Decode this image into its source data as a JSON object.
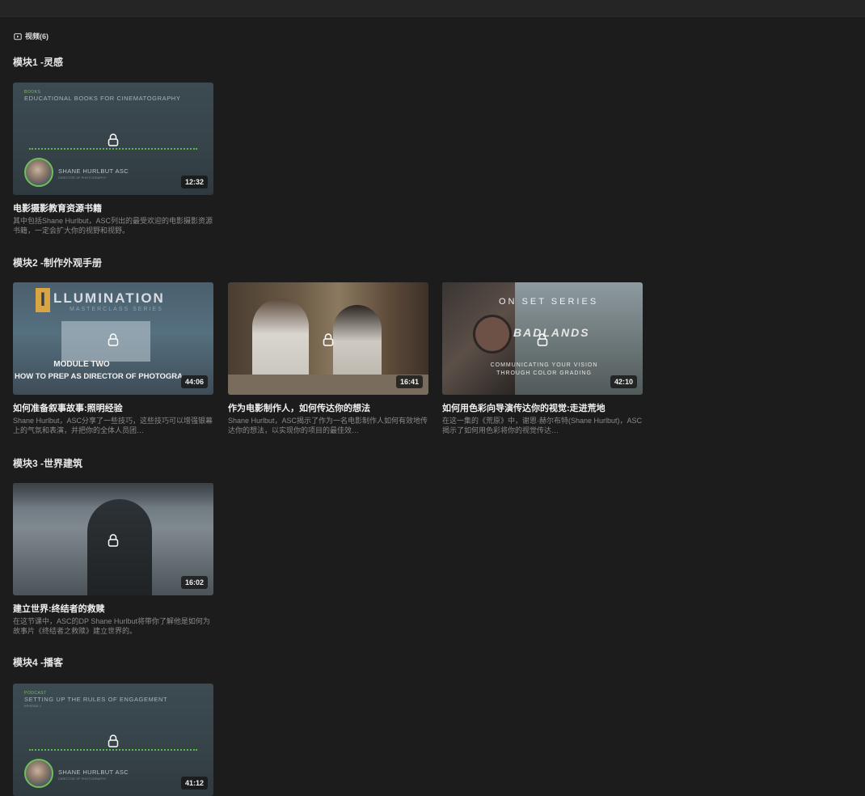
{
  "section": {
    "label": "视频(6)",
    "icon": "video-icon"
  },
  "modules": [
    {
      "title": "模块1 -灵感",
      "videos": [
        {
          "title": "电影摄影教育资源书籍",
          "description": "其中包括Shane Hurlbut，ASC列出的最受欢迎的电影摄影资源书籍，一定会扩大你的视野和视野。",
          "duration": "12:32",
          "thumb": {
            "tag": "BOOKS",
            "heading": "EDUCATIONAL BOOKS FOR CINEMATOGRAPHY",
            "name": "SHANE HURLBUT ASC",
            "role": "DIRECTOR OF PHOTOGRAPHY"
          }
        }
      ]
    },
    {
      "title": "模块2 -制作外观手册",
      "videos": [
        {
          "title": "如何准备叙事故事:照明经验",
          "description": "Shane Hurlbut，ASC分享了一些技巧，这些技巧可以增强银幕上的气氛和表演，并把你的全体人员团…",
          "duration": "44:06",
          "thumb": {
            "letter": "I",
            "word": "LLUMINATION",
            "series": "MASTERCLASS SERIES",
            "module": "MODULE TWO",
            "how": "HOW TO PREP AS DIRECTOR OF PHOTOGRA"
          }
        },
        {
          "title": "作为电影制作人，如何传达你的想法",
          "description": "Shane Hurlbut，ASC揭示了作为一名电影制作人如何有效地传达你的想法，以实现你的项目的最佳效…",
          "duration": "16:41"
        },
        {
          "title": "如何用色彩向导演传达你的视觉:走进荒地",
          "description": "在这一集的《荒原》中，谢恩·赫尔布特(Shane Hurlbut)，ASC揭示了如何用色彩将你的视觉传达…",
          "duration": "42:10",
          "thumb": {
            "onset": "ON SET SERIES",
            "bad": "BADLANDS",
            "comm": "COMMUNICATING YOUR VISION THROUGH COLOR GRADING"
          }
        }
      ]
    },
    {
      "title": "模块3 -世界建筑",
      "videos": [
        {
          "title": "建立世界:终结者的救赎",
          "description": "在这节课中，ASC的DP Shane Hurlbut将带你了解他是如何为故事片《终结者之救赎》建立世界的。",
          "duration": "16:02"
        }
      ]
    },
    {
      "title": "模块4 -播客",
      "videos": [
        {
          "title": "",
          "description": "",
          "duration": "41:12",
          "thumb": {
            "tag": "PODCAST",
            "heading": "SETTING UP THE RULES OF ENGAGEMENT",
            "sub": "EPISODE 1",
            "name": "SHANE HURLBUT ASC",
            "role": "DIRECTOR OF PHOTOGRAPHY"
          }
        }
      ]
    }
  ]
}
